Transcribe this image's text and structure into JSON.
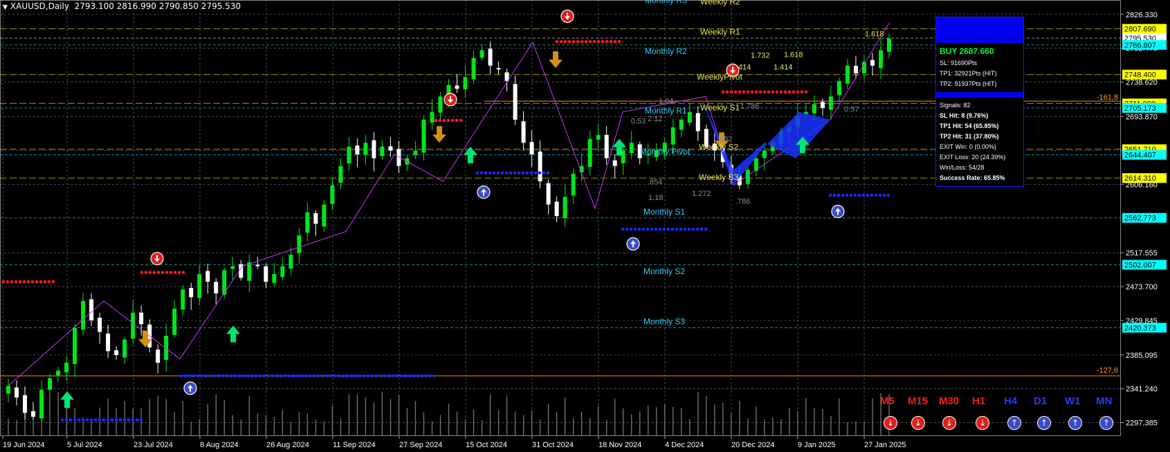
{
  "header": {
    "symbol": "XAUUSD,Daily",
    "ohlc": "2793.100 2816.990 2790.850 2795.530"
  },
  "chart_data": {
    "type": "candlestick",
    "title": "XAUUSD,Daily",
    "ylim": [
      2280,
      2845
    ],
    "y_ticks": [
      2826.33,
      2782.475,
      2738.62,
      2693.87,
      2650.015,
      2606.16,
      2517.555,
      2473.7,
      2429.845,
      2385.095,
      2341.24,
      2297.385
    ],
    "x_ticks": [
      "19 Jun 2024",
      "5 Jul 2024",
      "23 Jul 2024",
      "8 Aug 2024",
      "26 Aug 2024",
      "11 Sep 2024",
      "27 Sep 2024",
      "15 Oct 2024",
      "31 Oct 2024",
      "18 Nov 2024",
      "4 Dec 2024",
      "20 Dec 2024",
      "9 Jan 2025",
      "27 Jan 2025"
    ],
    "highlighted_prices": [
      {
        "label": "2807.690",
        "price": 2807.69,
        "bg": "#ffff00"
      },
      {
        "label": "2795.530",
        "price": 2795.53,
        "bg": "#ffffff"
      },
      {
        "label": "2786.807",
        "price": 2786.807,
        "bg": "#00ffff"
      },
      {
        "label": "2748.400",
        "price": 2748.4,
        "bg": "#ffff00"
      },
      {
        "label": "2711.000",
        "price": 2711.0,
        "bg": "#ffff00"
      },
      {
        "label": "2705.173",
        "price": 2705.173,
        "bg": "#00ffff"
      },
      {
        "label": "2651.710",
        "price": 2651.71,
        "bg": "#ffff00"
      },
      {
        "label": "2644.407",
        "price": 2644.407,
        "bg": "#00ffff"
      },
      {
        "label": "2614.310",
        "price": 2614.31,
        "bg": "#ffff00"
      },
      {
        "label": "2562.773",
        "price": 2562.773,
        "bg": "#00ffff"
      },
      {
        "label": "2502.007",
        "price": 2502.007,
        "bg": "#00ffff"
      },
      {
        "label": "2420.373",
        "price": 2420.373,
        "bg": "#00ffff"
      }
    ],
    "close_path": [
      2345,
      2330,
      2310,
      2305,
      2340,
      2355,
      2365,
      2375,
      2420,
      2455,
      2430,
      2415,
      2390,
      2385,
      2405,
      2440,
      2425,
      2395,
      2375,
      2410,
      2445,
      2470,
      2460,
      2490,
      2480,
      2465,
      2495,
      2500,
      2485,
      2505,
      2500,
      2480,
      2490,
      2500,
      2515,
      2540,
      2570,
      2555,
      2580,
      2605,
      2630,
      2655,
      2645,
      2660,
      2640,
      2655,
      2650,
      2630,
      2640,
      2650,
      2690,
      2700,
      2720,
      2735,
      2730,
      2745,
      2770,
      2780,
      2760,
      2755,
      2740,
      2690,
      2660,
      2645,
      2610,
      2580,
      2565,
      2590,
      2620,
      2630,
      2665,
      2670,
      2640,
      2630,
      2650,
      2660,
      2640,
      2645,
      2650,
      2660,
      2680,
      2690,
      2700,
      2675,
      2655,
      2650,
      2635,
      2615,
      2605,
      2625,
      2640,
      2650,
      2660,
      2675,
      2680,
      2695,
      2700,
      2710,
      2705,
      2720,
      2740,
      2760,
      2750,
      2765,
      2760,
      2780,
      2795
    ],
    "level_labels": [
      {
        "text": "Monthly R3",
        "price": 2841,
        "color": "#33ccff"
      },
      {
        "text": "Weekly R2",
        "price": 2839,
        "color": "#e8e85a"
      },
      {
        "text": "Weekly R1",
        "price": 2800,
        "color": "#e8e85a"
      },
      {
        "text": "Monthly R2",
        "price": 2775,
        "color": "#33ccff"
      },
      {
        "text": "WeeklyPivot",
        "price": 2742,
        "color": "#e8e85a"
      },
      {
        "text": "Monthly R1",
        "price": 2698,
        "color": "#33ccff"
      },
      {
        "text": "Weekly S1",
        "price": 2702,
        "color": "#e8e85a"
      },
      {
        "text": "Weekly S2",
        "price": 2651,
        "color": "#e8e85a"
      },
      {
        "text": "Monthly Pivot",
        "price": 2645,
        "color": "#33ccff"
      },
      {
        "text": "Weekly S3",
        "price": 2612,
        "color": "#e8e85a"
      },
      {
        "text": "Monthly S1",
        "price": 2567,
        "color": "#33ccff"
      },
      {
        "text": "Monthly S2",
        "price": 2490,
        "color": "#33ccff"
      },
      {
        "text": "Monthly S3",
        "price": 2425,
        "color": "#33ccff"
      }
    ],
    "fib_labels": [
      "1.732",
      "1.618",
      "1.414",
      "414",
      "1.04",
      "0.53",
      "2.12",
      "1.786",
      "882",
      ".854",
      "1.18",
      "1.272",
      ".786",
      "0.57",
      "1.618",
      "-161,8",
      "-127,6"
    ]
  },
  "panel": {
    "buy": "BUY 2687.660",
    "sl": "SL: 91690Pts",
    "tp1": "TP1: 32921Pts (HIT)",
    "tp2": "TP2: 91937Pts (HIT)",
    "signals": "Signals: 82",
    "sl_hit": "SL Hit: 8 (9.76%)",
    "tp1_hit": "TP1 Hit: 54 (65.85%)",
    "tp2_hit": "TP2 Hit: 31 (37.80%)",
    "exit_win": "EXIT Win: 0 (0.00%)",
    "exit_loss": "EXIT Loss: 20 (24.39%)",
    "win_loss": "Win/Loss: 54/28",
    "success": "Success Rate: 65.85%"
  },
  "timeframes": [
    {
      "label": "M5",
      "color": "#ff1a1a",
      "dir": "down"
    },
    {
      "label": "M15",
      "color": "#ff1a1a",
      "dir": "down"
    },
    {
      "label": "M30",
      "color": "#ff1a1a",
      "dir": "down"
    },
    {
      "label": "H1",
      "color": "#ff1a1a",
      "dir": "down"
    },
    {
      "label": "H4",
      "color": "#2a3cff",
      "dir": "up"
    },
    {
      "label": "D1",
      "color": "#2a3cff",
      "dir": "up"
    },
    {
      "label": "W1",
      "color": "#2a3cff",
      "dir": "up"
    },
    {
      "label": "MN",
      "color": "#2a3cff",
      "dir": "up"
    }
  ]
}
